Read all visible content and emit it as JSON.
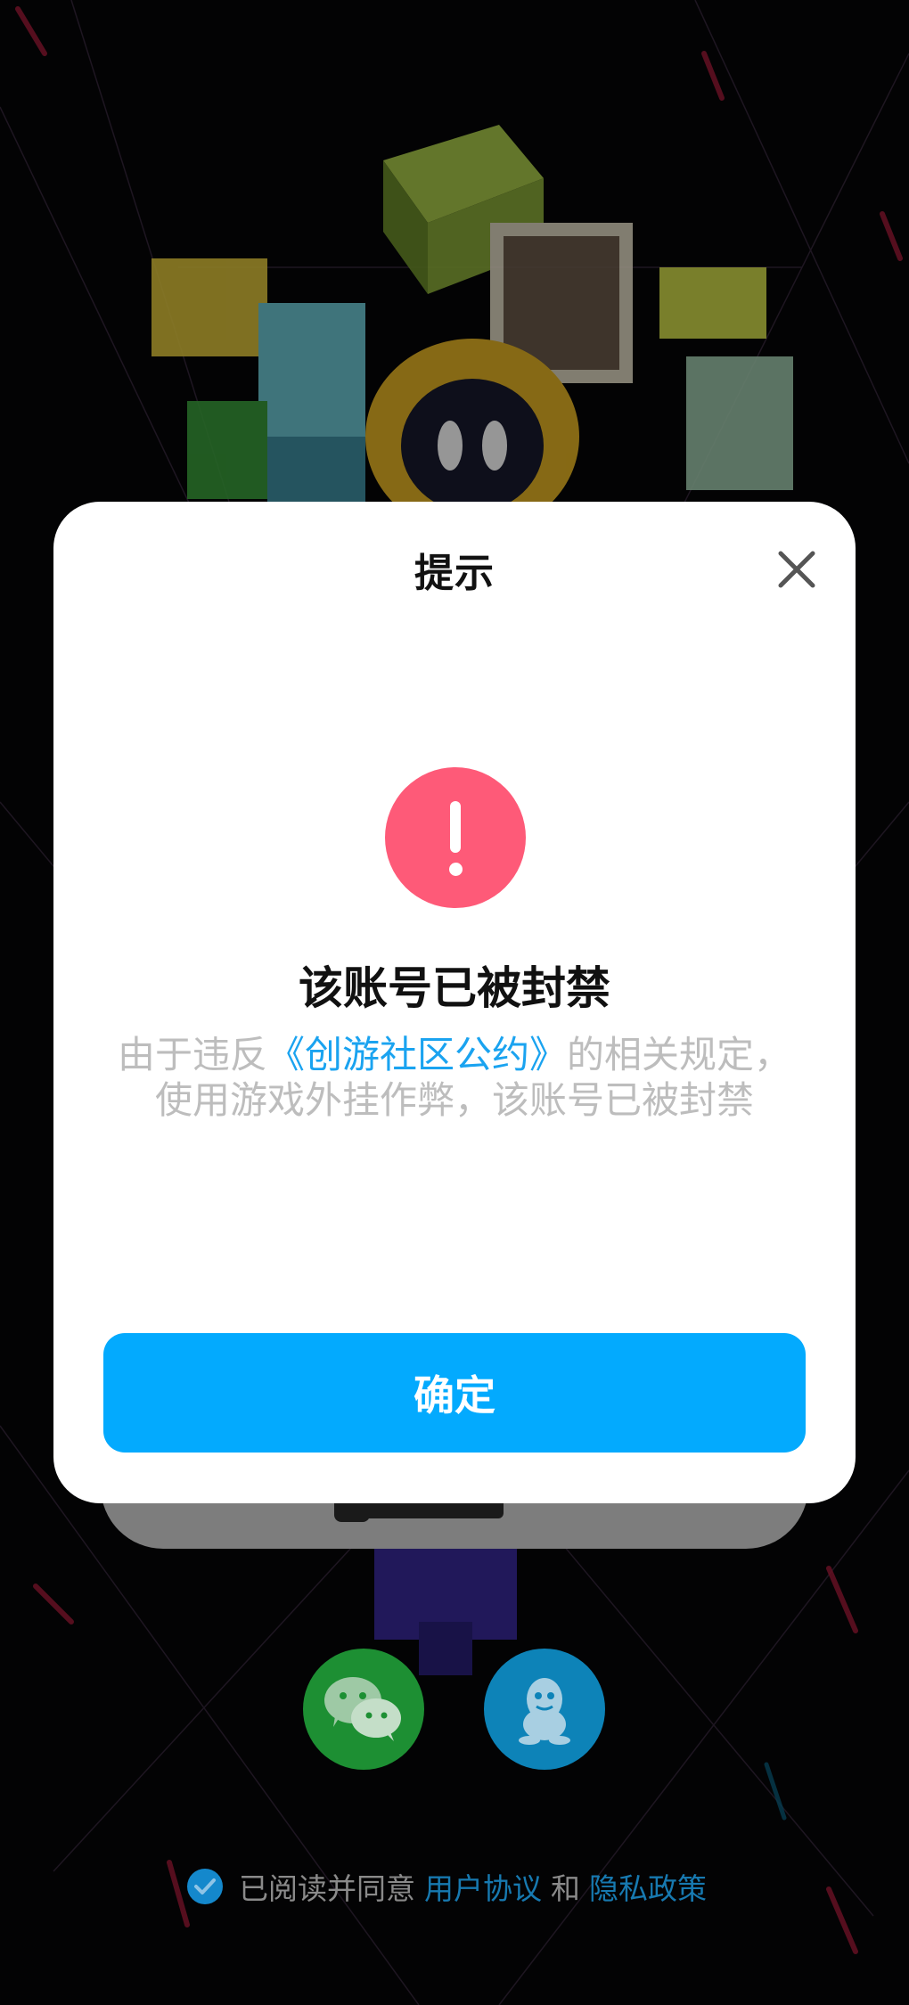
{
  "dialog": {
    "title": "提示",
    "heading": "该账号已被封禁",
    "message_prefix": "由于违反",
    "message_link": "《创游社区公约》",
    "message_suffix": "的相关规定，使用游戏外挂作弊，该账号已被封禁",
    "confirm_label": "确定",
    "accent_color": "#03aafe",
    "alert_color": "#fe5a78",
    "close_icon": "close-icon",
    "alert_icon": "exclamation-icon"
  },
  "login": {
    "wechat_icon": "wechat-icon",
    "qq_icon": "qq-icon"
  },
  "agreement": {
    "prefix": "已阅读并同意",
    "user_agreement": "用户协议",
    "and": "和",
    "privacy_policy": "隐私政策",
    "checked": true
  }
}
